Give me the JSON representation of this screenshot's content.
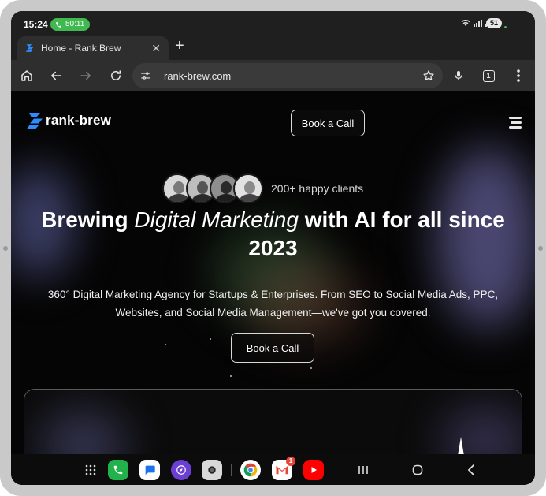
{
  "status": {
    "time": "15:24",
    "call_timer": "50:11",
    "battery": "51"
  },
  "browser": {
    "tab_title": "Home - Rank Brew",
    "url": "rank-brew.com",
    "tab_count": "1"
  },
  "site": {
    "logo_text": "rank-brew",
    "header_cta": "Book a Call",
    "clients_label": "200+ happy clients",
    "hero_title_pre": "Brewing ",
    "hero_title_em": "Digital Marketing",
    "hero_title_post": " with AI for all since 2023",
    "hero_sub_line1": "360° Digital Marketing Agency for Startups & Enterprises. From SEO to Social Media Ads, PPC,",
    "hero_sub_line2": "Websites, and Social Media Management—we've got you covered.",
    "hero_cta": "Book a Call"
  },
  "taskbar": {
    "apps": [
      "apps-grid-icon",
      "phone-app",
      "messages-app",
      "internet-app",
      "camera-app",
      "chrome-app",
      "gmail-app",
      "youtube-app"
    ],
    "gmail_badge": "1"
  },
  "colors": {
    "call_green": "#3fb950",
    "brand_blue": "#2f8cff",
    "page_bg": "#050505"
  }
}
